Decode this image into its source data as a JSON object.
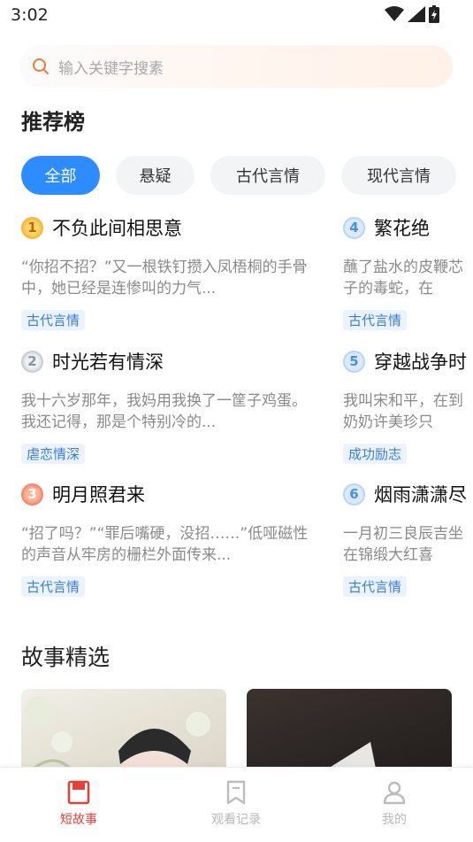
{
  "status_bar": {
    "time": "3:02",
    "icons": [
      "wifi-icon",
      "signal-icon",
      "battery-icon"
    ]
  },
  "search": {
    "placeholder": "输入关键字搜素"
  },
  "ranking": {
    "title": "推荐榜",
    "tabs": [
      {
        "label": "全部",
        "active": true
      },
      {
        "label": "悬疑",
        "active": false
      },
      {
        "label": "古代言情",
        "active": false
      },
      {
        "label": "现代言情",
        "active": false
      }
    ],
    "items": [
      {
        "rank": "1",
        "title": "不负此间相思意",
        "desc": "“你招不招？”又一根铁钉攒入凤梧桐的手骨中，她已经是连惨叫的力气...",
        "tag": "古代言情"
      },
      {
        "rank": "2",
        "title": "时光若有情深",
        "desc": "我十六岁那年，我妈用我换了一筐子鸡蛋。我还记得，那是个特别冷的...",
        "tag": "虐恋情深"
      },
      {
        "rank": "3",
        "title": "明月照君来",
        "desc": "“招了吗？”“罪后嘴硬，没招……”低哑磁性的声音从牢房的栅栏外面传来...",
        "tag": "古代言情"
      },
      {
        "rank": "4",
        "title": "繁花绝",
        "desc": "蘸了盐水的皮鞭芯子的毒蛇，在",
        "tag": "古代言情"
      },
      {
        "rank": "5",
        "title": "穿越战争时",
        "desc": "我叫宋和平，在到奶奶许美珍只",
        "tag": "成功励志"
      },
      {
        "rank": "6",
        "title": "烟雨潇潇尽",
        "desc": "一月初三良辰吉坐在锦缎大红喜",
        "tag": "古代言情"
      }
    ]
  },
  "stories": {
    "title": "故事精选"
  },
  "bottom_nav": {
    "items": [
      {
        "label": "短故事",
        "icon": "book-icon",
        "active": true
      },
      {
        "label": "观看记录",
        "icon": "bookmark-icon",
        "active": false
      },
      {
        "label": "我的",
        "icon": "user-icon",
        "active": false
      }
    ]
  },
  "colors": {
    "accent": "#2d8cff",
    "active_nav": "#e2423a",
    "tag_text": "#3a7fd4",
    "tag_bg": "#ebf3ff"
  }
}
